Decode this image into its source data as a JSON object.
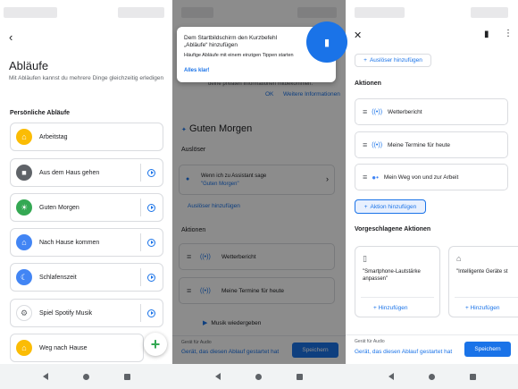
{
  "screen1": {
    "title": "Abläufe",
    "subtitle": "Mit Abläufen kannst du mehrere Dinge gleichzeitig erledigen",
    "section": "Persönliche Abläufe",
    "routines": [
      {
        "label": "Arbeitstag",
        "icon": "home-work-icon",
        "color": "#fbbc04"
      },
      {
        "label": "Aus dem Haus gehen",
        "icon": "car-icon",
        "color": "#5f6368"
      },
      {
        "label": "Guten Morgen",
        "icon": "sunrise-icon",
        "color": "#34a853"
      },
      {
        "label": "Nach Hause kommen",
        "icon": "house-icon",
        "color": "#4285f4"
      },
      {
        "label": "Schlafenszeit",
        "icon": "moon-icon",
        "color": "#4285f4"
      },
      {
        "label": "Spiel Spotify Musik",
        "icon": "gear-icon",
        "color": "#5f6368"
      },
      {
        "label": "Weg nach Hause",
        "icon": "home-route-icon",
        "color": "#fbbc04"
      }
    ],
    "fab_symbol": "+"
  },
  "screen2": {
    "tooltip_title": "Dem Startbildschirm den Kurzbefehl „Abläufe“ hinzufügen",
    "tooltip_body": "Häufige Abläufe mit einem einzigen Tippen starten",
    "tooltip_link": "Alles klar!",
    "faint_text": "deine privaten Informationen mitbekommen.",
    "ok": "OK",
    "more_info": "Weitere Informationen",
    "routine_title": "Guten Morgen",
    "trigger_heading": "Auslöser",
    "trigger_label": "Wenn ich zu Assistant sage",
    "trigger_value": "\"Guten Morgen\"",
    "add_trigger": "Auslöser hinzufügen",
    "actions_heading": "Aktionen",
    "actions": [
      "Wetterbericht",
      "Meine Termine für heute",
      "Musik wiedergeben"
    ],
    "device_label": "Gerät für Audio",
    "device_value": "Gerät, das diesen Ablauf gestartet hat",
    "save": "Speichern"
  },
  "screen3": {
    "add_trigger": "Auslöser hinzufügen",
    "actions_heading": "Aktionen",
    "actions": [
      "Wetterbericht",
      "Meine Termine für heute",
      "Mein Weg von und zur Arbeit"
    ],
    "add_action": "Aktion hinzufügen",
    "suggested_heading": "Vorgeschlagene Aktionen",
    "suggestions": [
      "\"Smartphone-Lautstärke anpassen\"",
      "\"Intelligente Geräte st"
    ],
    "suggestion_add": "Hinzufügen",
    "device_label": "Gerät für Audio",
    "device_value": "Gerät, das diesen Ablauf gestartet hat",
    "save": "Speichern"
  }
}
